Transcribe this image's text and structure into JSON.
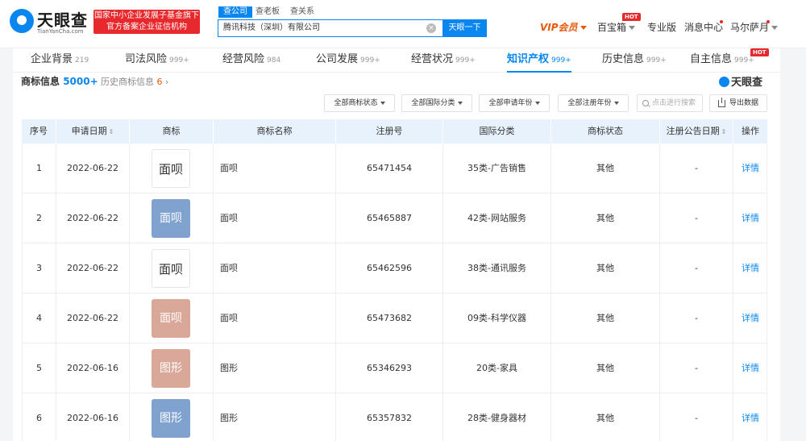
{
  "header": {
    "logo_text": "天眼查",
    "logo_subtext": "TianYanCha.com",
    "badge_line1": "国家中小企业发展子基金旗下",
    "badge_line2": "官方备案企业征信机构",
    "search_tabs": [
      "查公司",
      "查老板",
      "查关系"
    ],
    "search_value": "腾讯科技（深圳）有限公司",
    "search_button": "天眼一下",
    "vip": "VIP会员",
    "baibaoxiang": "百宝箱",
    "hot": "HOT",
    "pro": "专业版",
    "messages": "消息中心",
    "user": "马尔萨月"
  },
  "tabs": [
    {
      "label": "企业背景",
      "count": "219"
    },
    {
      "label": "司法风险",
      "count": "999+"
    },
    {
      "label": "经营风险",
      "count": "984"
    },
    {
      "label": "公司发展",
      "count": "999+"
    },
    {
      "label": "经营状况",
      "count": "999+"
    },
    {
      "label": "知识产权",
      "count": "999+",
      "active": true
    },
    {
      "label": "历史信息",
      "count": "999+"
    },
    {
      "label": "自主信息",
      "count": "999+",
      "hot": "HOT"
    }
  ],
  "section": {
    "title": "商标信息",
    "count": "5000+",
    "history_label": "历史商标信息",
    "history_count": "6",
    "brand": "天眼查"
  },
  "filters": {
    "status": "全部商标状态",
    "intl_class": "全部国际分类",
    "apply_year": "全部申请年份",
    "reg_year": "全部注册年份",
    "search_placeholder": "点击进行搜索",
    "export": "导出数据"
  },
  "table": {
    "headers": [
      "序号",
      "申请日期",
      "商标",
      "商标名称",
      "注册号",
      "国际分类",
      "商标状态",
      "注册公告日期",
      "操作"
    ],
    "rows": [
      {
        "no": "1",
        "date": "2022-06-22",
        "mark": "面呗",
        "mark_style": "plain",
        "name": "面呗",
        "reg_no": "65471454",
        "intl": "35类-广告销售",
        "status": "其他",
        "pub_date": "-",
        "action": "详情"
      },
      {
        "no": "2",
        "date": "2022-06-22",
        "mark": "面呗",
        "mark_style": "blue",
        "name": "面呗",
        "reg_no": "65465887",
        "intl": "42类-网站服务",
        "status": "其他",
        "pub_date": "-",
        "action": "详情"
      },
      {
        "no": "3",
        "date": "2022-06-22",
        "mark": "面呗",
        "mark_style": "plain",
        "name": "面呗",
        "reg_no": "65462596",
        "intl": "38类-通讯服务",
        "status": "其他",
        "pub_date": "-",
        "action": "详情"
      },
      {
        "no": "4",
        "date": "2022-06-22",
        "mark": "面呗",
        "mark_style": "pink",
        "name": "面呗",
        "reg_no": "65473682",
        "intl": "09类-科学仪器",
        "status": "其他",
        "pub_date": "-",
        "action": "详情"
      },
      {
        "no": "5",
        "date": "2022-06-16",
        "mark": "图形",
        "mark_style": "pink",
        "name": "图形",
        "reg_no": "65346293",
        "intl": "20类-家具",
        "status": "其他",
        "pub_date": "-",
        "action": "详情"
      },
      {
        "no": "6",
        "date": "2022-06-16",
        "mark": "图形",
        "mark_style": "blue",
        "name": "图形",
        "reg_no": "65357832",
        "intl": "28类-健身器材",
        "status": "其他",
        "pub_date": "-",
        "action": "详情"
      }
    ]
  },
  "colors": {
    "brand_blue": "#0a86f0",
    "badge_red": "#e7282c",
    "vip_orange": "#e8590c",
    "header_row_bg": "#e8f2fd"
  }
}
